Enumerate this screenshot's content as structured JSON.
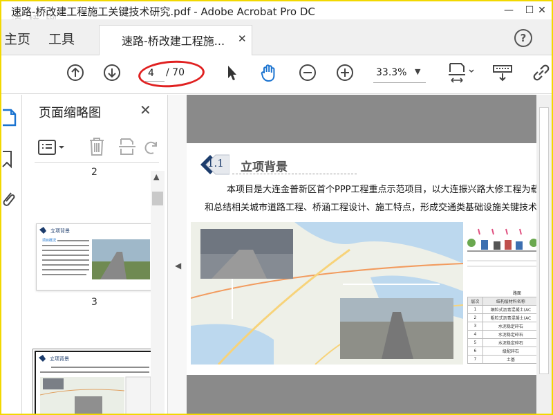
{
  "window": {
    "title": "速路-桥改建工程施工关键技术研究.pdf - Adobe Acrobat Pro DC",
    "watermark": "道 桥 网",
    "controls": {
      "minimize": "—",
      "maximize": "☐",
      "close": "✕"
    }
  },
  "nav": {
    "home_label": "主页",
    "tools_label": "工具",
    "doc_tab_label": "速路-桥改建工程施...",
    "doc_tab_close": "✕",
    "help": "?"
  },
  "toolbar": {
    "current_page": "4",
    "total_pages": "/ 70",
    "zoom": "33.3%",
    "zoom_arrow": "▼"
  },
  "thumbnails": {
    "title": "页面缩略图",
    "close": "✕",
    "page_labels": [
      "2",
      "3"
    ],
    "thumb_heading": "立项背景",
    "thumb_subheading": "项目概况"
  },
  "document": {
    "section_number": "1.1",
    "section_title": "立项背景",
    "paragraph_line1": "本项目是大连金普新区首个PPP工程重点示范项目，以大连振兴路大修工程为载体",
    "paragraph_line2": "和总结相关城市道路工程、桥涵工程设计、施工特点，形成交通类基础设施关键技术总",
    "table_header": "路面",
    "table": {
      "header": [
        "层次",
        "结构层材料名称"
      ],
      "rows": [
        [
          "1",
          "细粒式沥青混凝土(AC"
        ],
        [
          "2",
          "粗粒式沥青混凝土(AC"
        ],
        [
          "3",
          "水泥稳定碎石"
        ],
        [
          "4",
          "水泥稳定碎石"
        ],
        [
          "5",
          "水泥稳定碎石"
        ],
        [
          "6",
          "级配碎石"
        ],
        [
          "7",
          "土基"
        ]
      ]
    }
  },
  "colors": {
    "accent_oval": "#e02020",
    "frame": "#f2d800",
    "hand_tool": "#1a73d0",
    "section_badge": "#1c3c6c"
  }
}
